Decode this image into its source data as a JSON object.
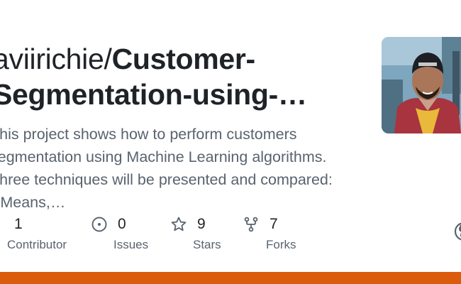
{
  "repo": {
    "owner": "aviirichie/",
    "name_line1": "Customer-",
    "name_line2": "Segmentation-using-…"
  },
  "description": {
    "lines": [
      "This project shows how to perform customers",
      "segmentation using Machine Learning algorithms.",
      "Three techniques will be presented and compared:",
      "KMeans,…"
    ]
  },
  "stats": {
    "contributors": {
      "value": "1",
      "label": "Contributor",
      "icon": "people-icon"
    },
    "issues": {
      "value": "0",
      "label": "Issues",
      "icon": "issue-opened-icon"
    },
    "stars": {
      "value": "9",
      "label": "Stars",
      "icon": "star-icon"
    },
    "forks": {
      "value": "7",
      "label": "Forks",
      "icon": "repo-forked-icon"
    }
  },
  "colors": {
    "accent_bar": "#da5b0b",
    "text_primary": "#1f2328",
    "text_secondary": "#59636e"
  }
}
